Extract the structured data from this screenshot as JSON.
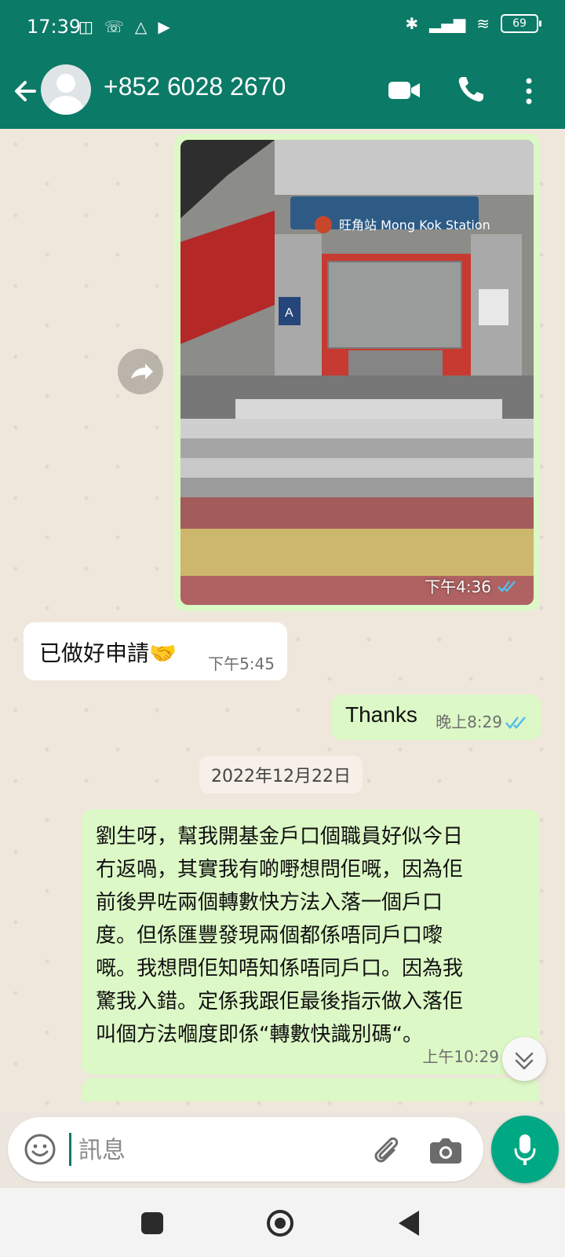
{
  "status_bar": {
    "time": "17:39",
    "battery": "69",
    "left_icons": [
      "nfc-icon",
      "missed-call-icon",
      "drive-icon",
      "play-icon"
    ],
    "right_icons": [
      "bluetooth-icon",
      "signal-icon",
      "wifi-icon",
      "battery-icon"
    ]
  },
  "header": {
    "contact_name": "+852 6028 2670",
    "icons": [
      "back-arrow-icon",
      "avatar",
      "video-call-icon",
      "voice-call-icon",
      "more-options-icon"
    ]
  },
  "chat": {
    "image_message": {
      "station_sign": "旺角站 Mong Kok Station",
      "exit_sign": "A",
      "time": "下午4:36"
    },
    "incoming_message": {
      "text": "已做好申請🤝",
      "time": "下午5:45"
    },
    "outgoing_message": {
      "text": "Thanks",
      "time": "晚上8:29"
    },
    "date_divider": "2022年12月22日",
    "long_message": {
      "text": "劉生呀，幫我開基金戶口個職員好似今日\n冇返喎，其實我有啲嘢想問佢嘅，因為佢\n前後畀咗兩個轉數快方法入落一個戶口\n度。但係匯豐發現兩個都係唔同戶口嚟\n嘅。我想問佢知唔知係唔同戶口。因為我\n驚我入錯。定係我跟佢最後指示做入落佢\n叫個方法嗰度即係“轉數快識別碼“。",
      "time": "上午10:29"
    }
  },
  "input": {
    "placeholder": "訊息"
  },
  "colors": {
    "header": "#0b7a67",
    "outgoing_bubble": "#dcf8c6",
    "incoming_bubble": "#ffffff",
    "mic_button": "#00a884",
    "read_ticks": "#53bdeb"
  }
}
